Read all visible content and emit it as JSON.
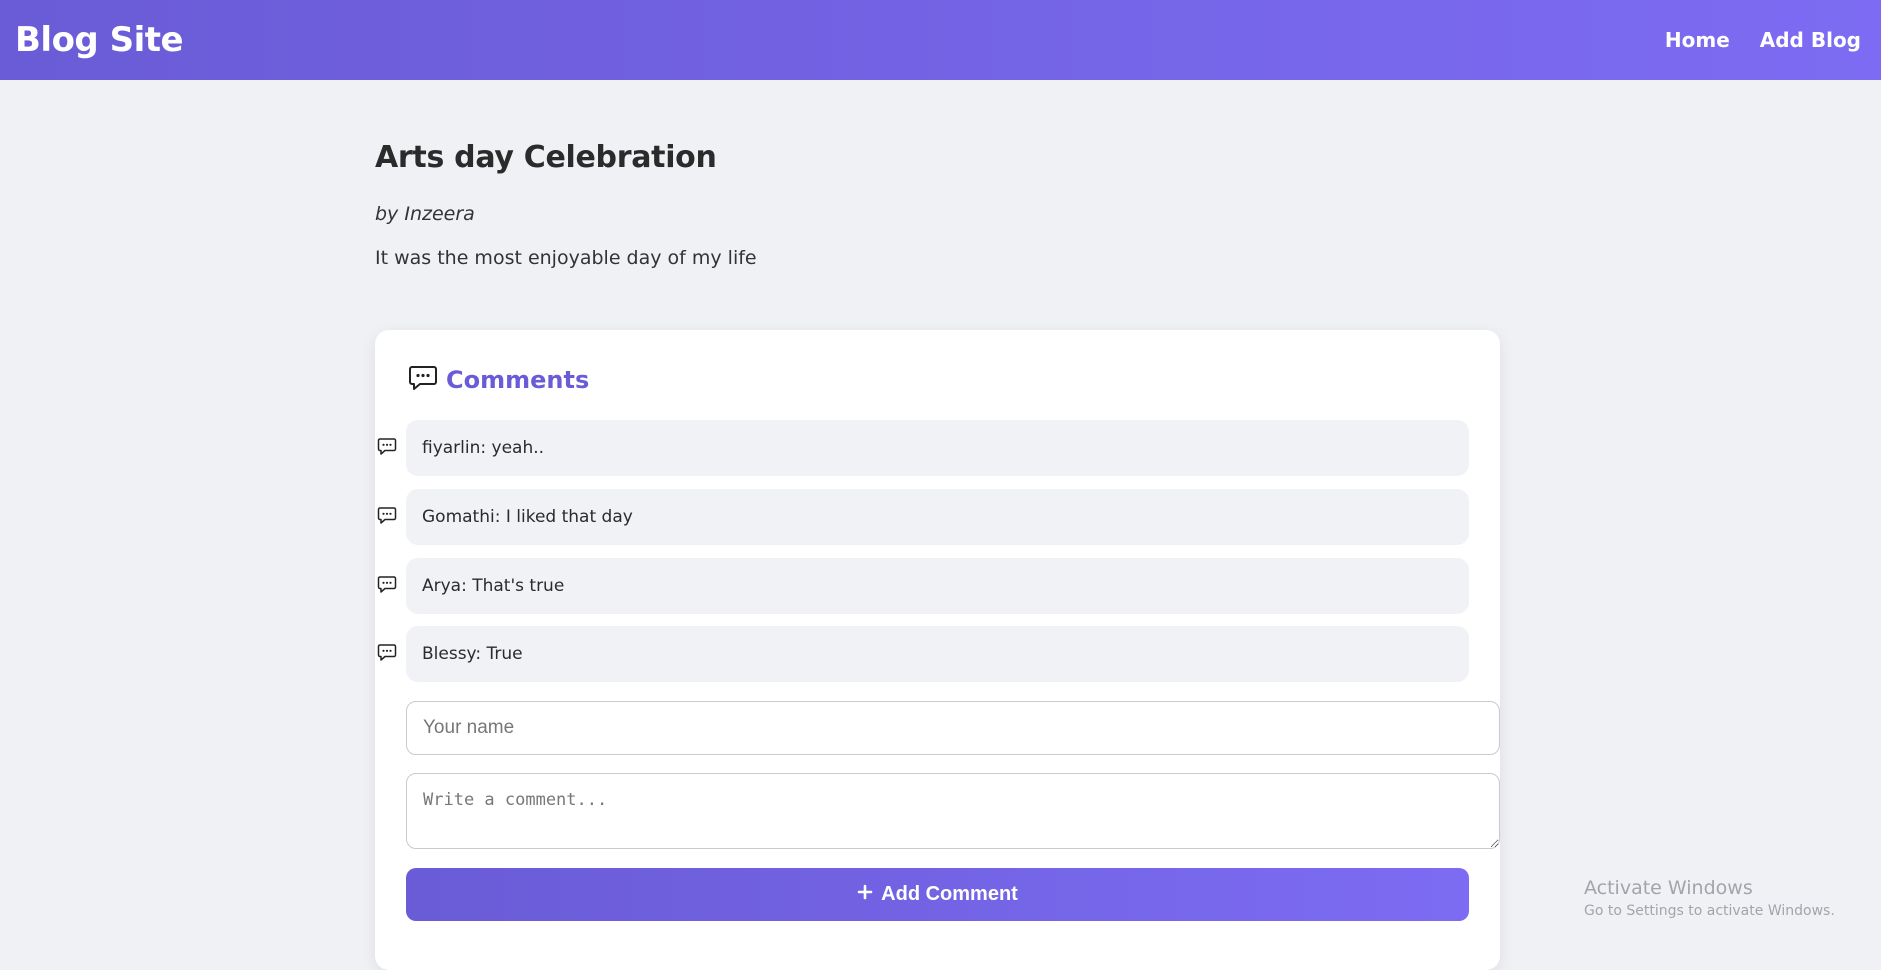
{
  "header": {
    "brand": "Blog Site",
    "nav": [
      {
        "label": "Home"
      },
      {
        "label": "Add Blog"
      }
    ]
  },
  "post": {
    "title": "Arts day Celebration",
    "author": "by Inzeera",
    "body": "It was the most enjoyable day of my life"
  },
  "comments": {
    "heading": "Comments",
    "heading_icon": "comment-icon",
    "items": [
      {
        "text": "fiyarlin: yeah.."
      },
      {
        "text": "Gomathi: I liked that day"
      },
      {
        "text": "Arya: That's true"
      },
      {
        "text": "Blessy: True"
      }
    ],
    "form": {
      "name_placeholder": "Your name",
      "name_value": "",
      "comment_placeholder": "Write a comment...",
      "comment_value": "",
      "submit_label": "Add Comment",
      "submit_icon": "plus-icon"
    }
  },
  "watermark": {
    "line1": "Activate Windows",
    "line2": "Go to Settings to activate Windows."
  },
  "colors": {
    "accent": "#6a5bd6",
    "accent_end": "#7d6cf3",
    "background": "#f0f1f5",
    "bubble": "#f1f2f5"
  }
}
